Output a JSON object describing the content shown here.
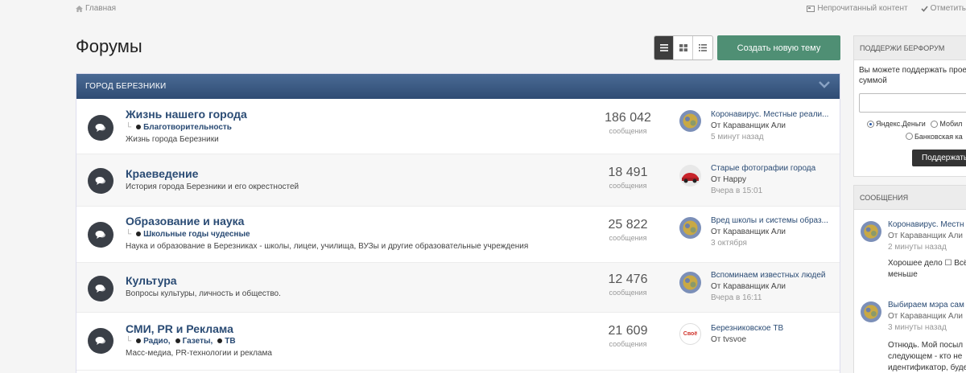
{
  "breadcrumb": {
    "home": "Главная"
  },
  "top_links": {
    "unread": "Непрочитанный контент",
    "mark": "Отметить"
  },
  "page_title": "Форумы",
  "actions": {
    "new_topic": "Создать новую тему"
  },
  "category": {
    "title": "ГОРОД БЕРЕЗНИКИ"
  },
  "forums": [
    {
      "title": "Жизнь нашего города",
      "subforums": [
        "Благотворительность"
      ],
      "description": "Жизнь города Березники",
      "count": "186 042",
      "count_label": "сообщения",
      "last_title": "Коронавирус. Местные реали...",
      "last_author": "От Караванщик Али",
      "last_time": "5 минут назад"
    },
    {
      "title": "Краеведение",
      "subforums": [],
      "description": "История города Березники и его окрестностей",
      "count": "18 491",
      "count_label": "сообщения",
      "last_title": "Старые фотографии города",
      "last_author": "От Happy",
      "last_time": "Вчера в 15:01"
    },
    {
      "title": "Образование и наука",
      "subforums": [
        "Школьные годы чудесные"
      ],
      "description": "Наука и образование в Березниках - школы, лицеи, училища, ВУЗы и другие образовательные учреждения",
      "count": "25 822",
      "count_label": "сообщения",
      "last_title": "Вред школы и системы образ...",
      "last_author": "От Караванщик Али",
      "last_time": "3 октября"
    },
    {
      "title": "Культура",
      "subforums": [],
      "description": "Вопросы культуры, личность и общество.",
      "count": "12 476",
      "count_label": "сообщения",
      "last_title": "Вспоминаем известных людей",
      "last_author": "От Караванщик Али",
      "last_time": "Вчера в 16:11"
    },
    {
      "title": "СМИ, PR и Реклама",
      "subforums": [
        "Радио,",
        "Газеты,",
        "ТВ"
      ],
      "description": "Масс-медиа, PR-технологии и реклама",
      "count": "21 609",
      "count_label": "сообщения",
      "last_title": "Березниковское ТВ",
      "last_author": "От tvsvoe",
      "last_time": "",
      "avatar_text": "Своё"
    }
  ],
  "support_widget": {
    "title": "ПОДДЕРЖИ БЕРФОРУМ",
    "text_line1": "Вы можете поддержать прое",
    "text_line2": "суммой",
    "option_yandex": "Яндекс.Деньги",
    "option_mobile": "Мобил",
    "option_card": "Банковская ка",
    "pay_button": "Поддержать"
  },
  "messages_widget": {
    "title": "СООБЩЕНИЯ",
    "items": [
      {
        "title": "Коронавирус. Местн",
        "author": "От Караванщик Али",
        "time": "2 минуты назад",
        "excerpt1": "Хорошее дело ☐ Всё",
        "excerpt2": "меньше"
      },
      {
        "title": "Выбираем мэра сам",
        "author": "От Караванщик Али",
        "time": "3 минуты назад",
        "excerpt1": "Отнюдь. Мой посыл",
        "excerpt2": "следующем - кто не",
        "excerpt3": "идентификатор, буде"
      }
    ]
  },
  "colors": {
    "accent_green": "#4f8f74",
    "header_blue": "#2f4c73",
    "link_blue": "#2a4b74"
  }
}
